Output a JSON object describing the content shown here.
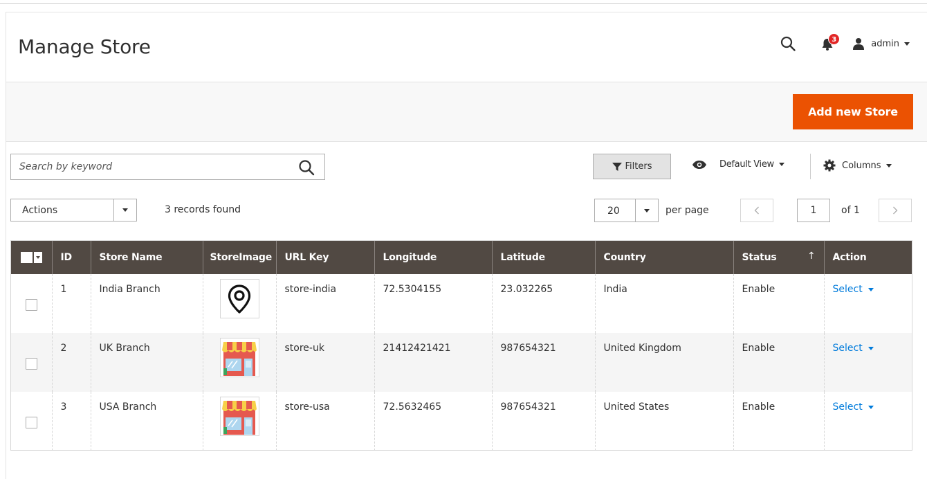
{
  "header": {
    "title": "Manage Store",
    "notifications_count": "3",
    "user_name": "admin"
  },
  "action_bar": {
    "add_button": "Add new Store"
  },
  "toolbar": {
    "search_placeholder": "Search by keyword",
    "filters_label": "Filters",
    "view_label": "Default View",
    "columns_label": "Columns",
    "actions_label": "Actions",
    "records_found": "3 records found",
    "per_page_value": "20",
    "per_page_label": "per page",
    "current_page": "1",
    "of_pages": "of 1"
  },
  "grid": {
    "columns": [
      "ID",
      "Store Name",
      "StoreImage",
      "URL Key",
      "Longitude",
      "Latitude",
      "Country",
      "Status",
      "Action"
    ],
    "sorted_column": "Status",
    "rows": [
      {
        "id": "1",
        "name": "India Branch",
        "image": "map-pin-icon",
        "url_key": "store-india",
        "longitude": "72.5304155",
        "latitude": "23.032265",
        "country": "India",
        "status": "Enable",
        "action": "Select"
      },
      {
        "id": "2",
        "name": "UK Branch",
        "image": "storefront-icon",
        "url_key": "store-uk",
        "longitude": "21412421421",
        "latitude": "987654321",
        "country": "United Kingdom",
        "status": "Enable",
        "action": "Select"
      },
      {
        "id": "3",
        "name": "USA Branch",
        "image": "storefront-icon",
        "url_key": "store-usa",
        "longitude": "72.5632465",
        "latitude": "987654321",
        "country": "United States",
        "status": "Enable",
        "action": "Select"
      }
    ]
  },
  "colors": {
    "accent": "#eb5202",
    "grid_header": "#514943",
    "link": "#007bdb",
    "badge": "#e22626"
  }
}
